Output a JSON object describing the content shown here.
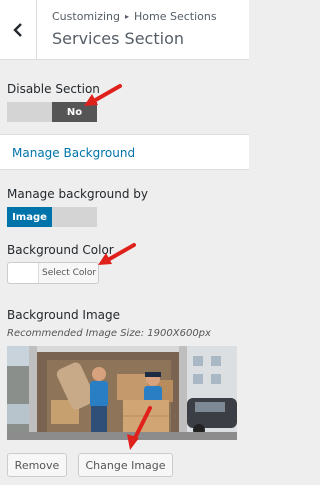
{
  "header": {
    "breadcrumb_root": "Customizing",
    "breadcrumb_separator": "▸",
    "breadcrumb_section": "Home Sections",
    "title": "Services Section",
    "back_icon": "chevron-left-icon"
  },
  "disable_section": {
    "label": "Disable Section",
    "value": "No"
  },
  "manage_background_link": "Manage Background",
  "manage_background_by": {
    "label": "Manage background by",
    "value": "Image"
  },
  "background_color": {
    "label": "Background Color",
    "button_label": "Select Color",
    "current_color": "#ffffff"
  },
  "background_image": {
    "label": "Background Image",
    "hint": "Recommended Image Size: 1900X600px",
    "remove_label": "Remove",
    "change_label": "Change Image"
  },
  "colors": {
    "accent": "#0073aa",
    "toggle_active": "#555555",
    "annotation_arrow": "#e0201b"
  }
}
